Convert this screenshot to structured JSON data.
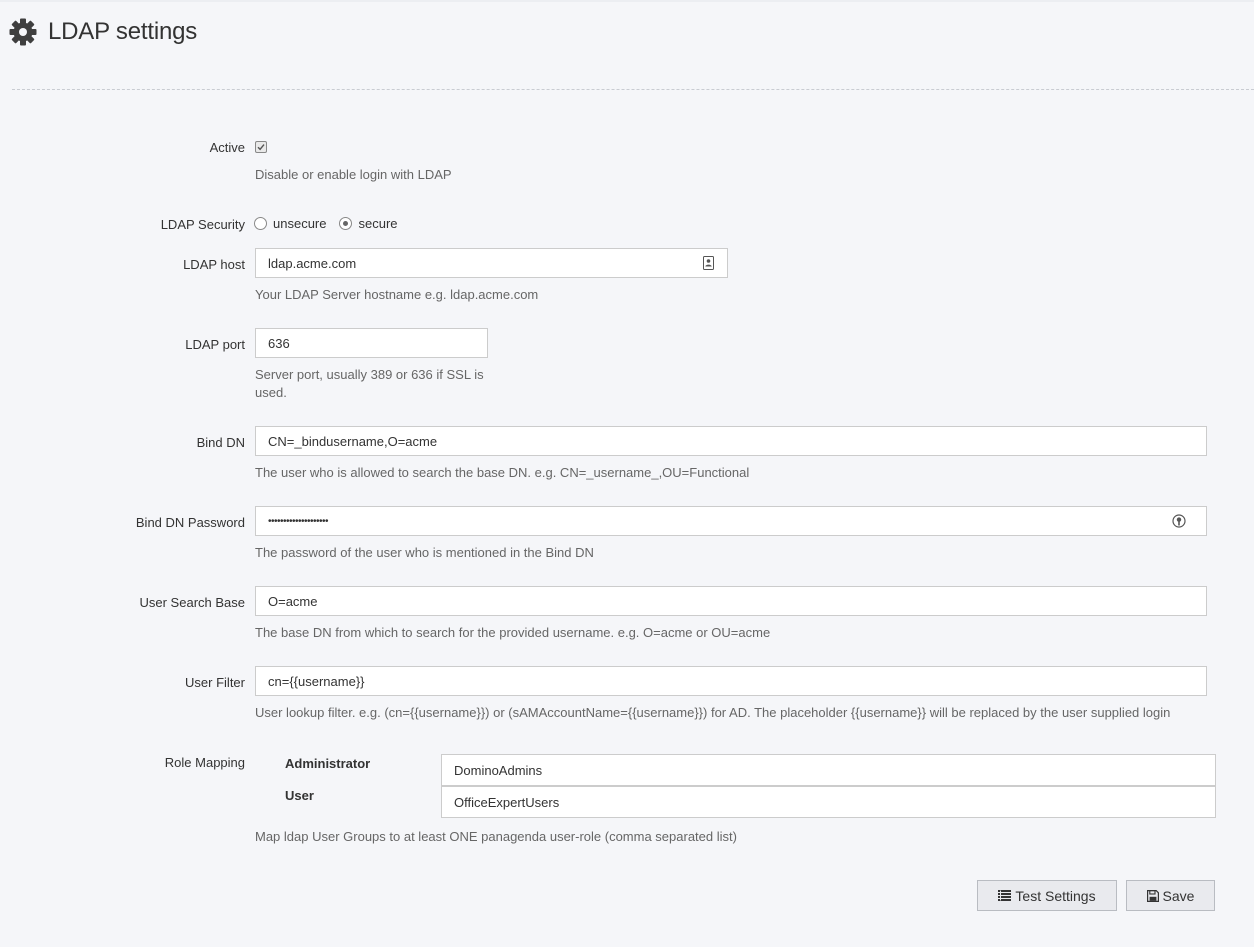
{
  "page": {
    "title": "LDAP settings"
  },
  "active": {
    "label": "Active",
    "checked": true,
    "help": "Disable or enable login with LDAP"
  },
  "security": {
    "label": "LDAP Security",
    "options": [
      "unsecure",
      "secure"
    ],
    "selected": "secure"
  },
  "host": {
    "label": "LDAP host",
    "value": "ldap.acme.com",
    "help": "Your LDAP Server hostname e.g. ldap.acme.com"
  },
  "port": {
    "label": "LDAP port",
    "value": "636",
    "help_line1": "Server port, usually 389 or 636 if SSL is",
    "help_line2": "used."
  },
  "bind_dn": {
    "label": "Bind DN",
    "value": "CN=_bindusername,O=acme",
    "help": "The user who is allowed to search the base DN. e.g. CN=_username_,OU=Functional"
  },
  "bind_password": {
    "label": "Bind DN Password",
    "value": "••••••••••••••••••••",
    "help": "The password of the user who is mentioned in the Bind DN"
  },
  "search_base": {
    "label": "User Search Base",
    "value": "O=acme",
    "help": "The base DN from which to search for the provided username. e.g. O=acme or OU=acme"
  },
  "user_filter": {
    "label": "User Filter",
    "value": "cn={{username}}",
    "help": "User lookup filter. e.g. (cn={{username}}) or (sAMAccountName={{username}}) for AD. The placeholder {{username}} will be replaced by the user supplied login"
  },
  "role_mapping": {
    "label": "Role Mapping",
    "roles": [
      {
        "name": "Administrator",
        "value": "DominoAdmins"
      },
      {
        "name": "User",
        "value": "OfficeExpertUsers"
      }
    ],
    "help": "Map ldap User Groups to at least ONE panagenda user-role (comma separated list)"
  },
  "buttons": {
    "test": "Test Settings",
    "save": "Save"
  },
  "icons": {
    "header": "gear-icon",
    "host_trail": "contact-card-icon",
    "password_trail": "key-icon",
    "test": "list-icon",
    "save": "floppy-disk-icon"
  },
  "colors": {
    "background": "#f5f6f9",
    "input_border": "#cccccc",
    "button_bg": "#e9eaee"
  }
}
